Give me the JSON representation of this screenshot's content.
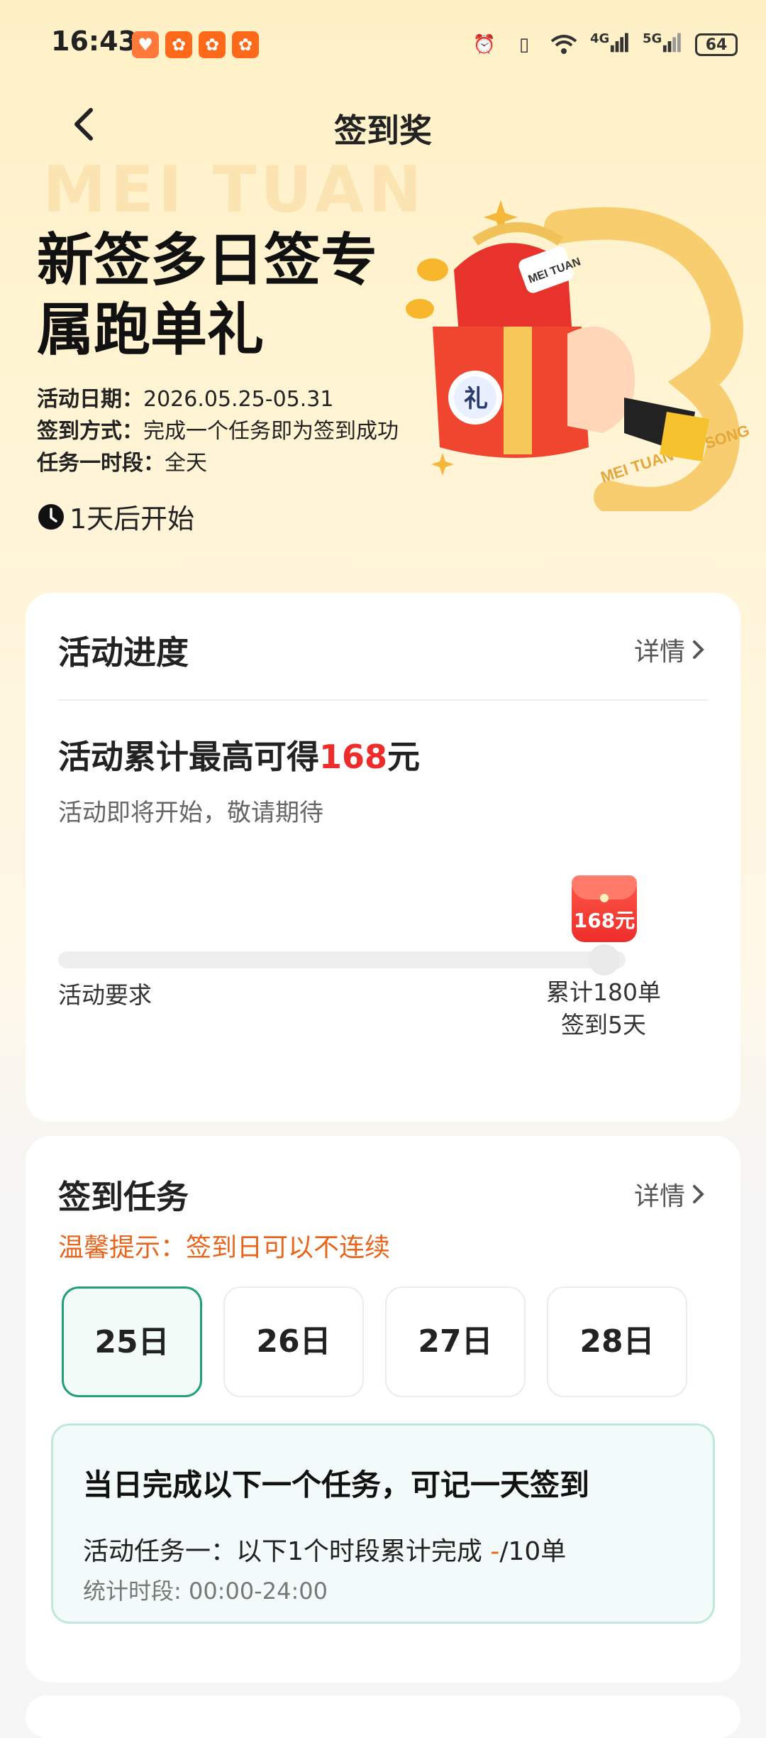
{
  "status_bar": {
    "time": "16:43",
    "battery": "64",
    "network_labels": [
      "4G",
      "5G"
    ]
  },
  "nav": {
    "title": "签到奖"
  },
  "hero": {
    "watermark": "MEI TUAN",
    "title_line1": "新签多日签专",
    "title_line2": "属跑单礼",
    "date_label": "活动日期：",
    "date_value": "2026.05.25-05.31",
    "method_label": "签到方式：",
    "method_value": "完成一个任务即为签到成功",
    "period_label": "任务一时段：",
    "period_value": "全天",
    "countdown": "1天后开始",
    "art_brand_text": "MEI TUAN PEI SONG",
    "art_gift_char": "礼",
    "art_box_label": "MEI TUAN"
  },
  "progress_card": {
    "title": "活动进度",
    "detail_label": "详情",
    "headline_prefix": "活动累计最高可得",
    "headline_amount": "168",
    "headline_suffix": "元",
    "subtitle": "活动即将开始，敬请期待",
    "progress_fraction": 0,
    "reward_label": "168元",
    "left_label": "活动要求",
    "target_line1": "累计180单",
    "target_line2": "签到5天"
  },
  "signin_card": {
    "title": "签到任务",
    "detail_label": "详情",
    "tip": "温馨提示：签到日可以不连续",
    "days": [
      {
        "label": "25日",
        "selected": true
      },
      {
        "label": "26日",
        "selected": false
      },
      {
        "label": "27日",
        "selected": false
      },
      {
        "label": "28日",
        "selected": false
      }
    ],
    "task_title": "当日完成以下一个任务，可记一天签到",
    "task_line_prefix": "活动任务一：以下1个时段累计完成 ",
    "task_progress": "-",
    "task_line_suffix": "/10单",
    "task_period": "统计时段: 00:00-24:00"
  },
  "colors": {
    "accent_red": "#ee2d2a",
    "tip_orange": "#e8651e",
    "selected_green": "#21a07a",
    "hero_bg": "#fff1c6"
  },
  "icons": {
    "back": "chevron-left-icon",
    "detail": "chevron-right-icon",
    "clock": "clock-icon"
  }
}
